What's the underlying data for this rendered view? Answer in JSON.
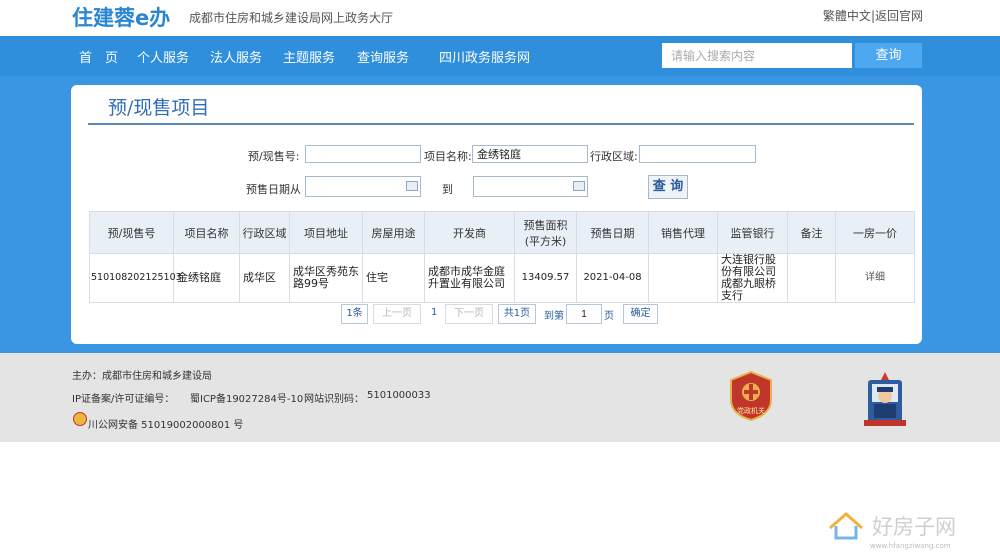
{
  "header": {
    "logo": "住建蓉e办",
    "subtitle": "成都市住房和城乡建设局网上政务大厅",
    "link_traditional": "繁體中文",
    "separator": "|",
    "link_back": "返回官网"
  },
  "nav": {
    "items": [
      "首　页",
      "个人服务",
      "法人服务",
      "主题服务",
      "查询服务",
      "四川政务服务网"
    ],
    "search_placeholder": "请输入搜索内容",
    "search_button": "查询"
  },
  "page": {
    "title": "预/现售项目"
  },
  "form": {
    "presale_no_label": "预/现售号:",
    "presale_no_value": "",
    "project_name_label": "项目名称:",
    "project_name_value": "金绣铭庭",
    "district_label": "行政区域:",
    "district_value": "",
    "date_from_label": "预售日期从",
    "date_from_value": "",
    "date_to_label": "到",
    "date_to_value": "",
    "query_button": "查 询"
  },
  "table": {
    "columns": [
      "预/现售号",
      "项目名称",
      "行政区域",
      "项目地址",
      "房屋用途",
      "开发商",
      "预售面积(平方米)",
      "预售日期",
      "销售代理",
      "监管银行",
      "备注",
      "一房一价"
    ],
    "rows": [
      {
        "presale_no": "510108202125103",
        "project_name": "金绣铭庭",
        "district": "成华区",
        "address": "成华区秀苑东路99号",
        "usage": "住宅",
        "developer": "成都市成华金庭升置业有限公司",
        "area": "13409.57",
        "date": "2021-04-08",
        "agent": "",
        "bank": "大连银行股份有限公司成都九眼桥支行",
        "remark": "",
        "price_link": "详细"
      }
    ]
  },
  "pager": {
    "count": "1条",
    "prev": "上一页",
    "current": "1",
    "next": "下一页",
    "total": "共1页",
    "goto_label": "到第",
    "goto_value": "1",
    "page_unit": "页",
    "confirm": "确定"
  },
  "footer": {
    "sponsor": "主办：成都市住房和城乡建设局",
    "icp_label": "IP证备案/许可证编号：",
    "icp_value": "蜀ICP备19027284号-10",
    "site_id_label": "网站识别码：",
    "site_id_value": "5101000033",
    "police_record": "川公网安备 51019002000801 号",
    "badge_text": "党政机关"
  },
  "watermark": {
    "text": "好房子网",
    "url": "www.hfangziwang.com"
  },
  "colors": {
    "primary_blue": "#2f8fdd",
    "band_blue": "#3a96e2",
    "logo_blue": "#2a86d0",
    "footer_gray": "#e4e4e4",
    "badge_red": "#c0362a"
  }
}
